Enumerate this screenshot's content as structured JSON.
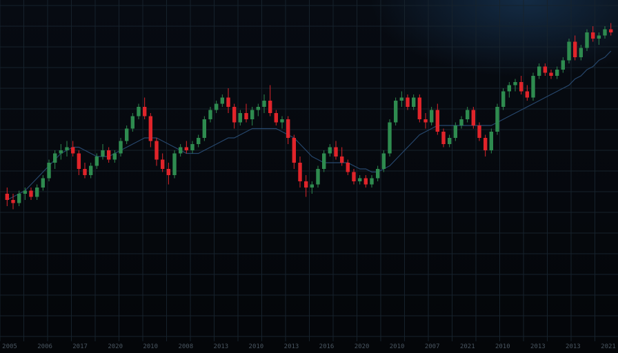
{
  "colors": {
    "up": "#2e8b4f",
    "down": "#e0242a",
    "moving_average": "#2b4f78",
    "grid": "#16222c",
    "background": "#05080d"
  },
  "chart_data": {
    "type": "candlestick",
    "grid": true,
    "legend": "none",
    "title": "",
    "xlabel": "",
    "ylabel": "",
    "ylim": [
      0,
      100
    ],
    "x_tick_labels": [
      "2005",
      "2006",
      "2017",
      "2020",
      "2010",
      "2008",
      "2013",
      "2010",
      "2013",
      "2016",
      "2020",
      "2010",
      "2007",
      "2021",
      "2010",
      "2013",
      "2013",
      "2021"
    ],
    "candles": [
      {
        "o": 42,
        "h": 44,
        "l": 38,
        "c": 40
      },
      {
        "o": 40,
        "h": 42,
        "l": 37,
        "c": 39
      },
      {
        "o": 39,
        "h": 43,
        "l": 38,
        "c": 42
      },
      {
        "o": 42,
        "h": 44,
        "l": 40,
        "c": 43
      },
      {
        "o": 43,
        "h": 44,
        "l": 40,
        "c": 41
      },
      {
        "o": 41,
        "h": 45,
        "l": 40,
        "c": 44
      },
      {
        "o": 44,
        "h": 48,
        "l": 43,
        "c": 47
      },
      {
        "o": 47,
        "h": 53,
        "l": 46,
        "c": 52
      },
      {
        "o": 52,
        "h": 56,
        "l": 50,
        "c": 55
      },
      {
        "o": 55,
        "h": 58,
        "l": 53,
        "c": 56
      },
      {
        "o": 56,
        "h": 59,
        "l": 54,
        "c": 57
      },
      {
        "o": 57,
        "h": 59,
        "l": 54,
        "c": 55
      },
      {
        "o": 55,
        "h": 56,
        "l": 48,
        "c": 50
      },
      {
        "o": 50,
        "h": 52,
        "l": 47,
        "c": 48
      },
      {
        "o": 48,
        "h": 52,
        "l": 47,
        "c": 51
      },
      {
        "o": 51,
        "h": 55,
        "l": 50,
        "c": 54
      },
      {
        "o": 54,
        "h": 58,
        "l": 53,
        "c": 56
      },
      {
        "o": 56,
        "h": 57,
        "l": 52,
        "c": 53
      },
      {
        "o": 53,
        "h": 56,
        "l": 52,
        "c": 55
      },
      {
        "o": 55,
        "h": 60,
        "l": 54,
        "c": 59
      },
      {
        "o": 59,
        "h": 64,
        "l": 58,
        "c": 63
      },
      {
        "o": 63,
        "h": 68,
        "l": 62,
        "c": 67
      },
      {
        "o": 67,
        "h": 71,
        "l": 66,
        "c": 70
      },
      {
        "o": 70,
        "h": 73,
        "l": 66,
        "c": 67
      },
      {
        "o": 67,
        "h": 68,
        "l": 57,
        "c": 59
      },
      {
        "o": 59,
        "h": 60,
        "l": 51,
        "c": 53
      },
      {
        "o": 53,
        "h": 55,
        "l": 49,
        "c": 50
      },
      {
        "o": 50,
        "h": 52,
        "l": 45,
        "c": 48
      },
      {
        "o": 48,
        "h": 56,
        "l": 47,
        "c": 55
      },
      {
        "o": 55,
        "h": 58,
        "l": 54,
        "c": 57
      },
      {
        "o": 57,
        "h": 59,
        "l": 55,
        "c": 56
      },
      {
        "o": 56,
        "h": 59,
        "l": 55,
        "c": 58
      },
      {
        "o": 58,
        "h": 61,
        "l": 57,
        "c": 60
      },
      {
        "o": 60,
        "h": 67,
        "l": 59,
        "c": 66
      },
      {
        "o": 66,
        "h": 70,
        "l": 65,
        "c": 69
      },
      {
        "o": 69,
        "h": 72,
        "l": 68,
        "c": 71
      },
      {
        "o": 71,
        "h": 74,
        "l": 70,
        "c": 73
      },
      {
        "o": 73,
        "h": 76,
        "l": 68,
        "c": 70
      },
      {
        "o": 70,
        "h": 71,
        "l": 63,
        "c": 65
      },
      {
        "o": 65,
        "h": 69,
        "l": 64,
        "c": 68
      },
      {
        "o": 68,
        "h": 71,
        "l": 65,
        "c": 66
      },
      {
        "o": 66,
        "h": 70,
        "l": 64,
        "c": 69
      },
      {
        "o": 69,
        "h": 71,
        "l": 67,
        "c": 70
      },
      {
        "o": 70,
        "h": 74,
        "l": 68,
        "c": 72
      },
      {
        "o": 72,
        "h": 77,
        "l": 67,
        "c": 68
      },
      {
        "o": 68,
        "h": 69,
        "l": 64,
        "c": 65
      },
      {
        "o": 65,
        "h": 67,
        "l": 63,
        "c": 66
      },
      {
        "o": 66,
        "h": 67,
        "l": 58,
        "c": 60
      },
      {
        "o": 60,
        "h": 61,
        "l": 50,
        "c": 52
      },
      {
        "o": 52,
        "h": 54,
        "l": 44,
        "c": 46
      },
      {
        "o": 46,
        "h": 48,
        "l": 41,
        "c": 44
      },
      {
        "o": 44,
        "h": 46,
        "l": 42,
        "c": 45
      },
      {
        "o": 45,
        "h": 51,
        "l": 44,
        "c": 50
      },
      {
        "o": 50,
        "h": 56,
        "l": 49,
        "c": 55
      },
      {
        "o": 55,
        "h": 58,
        "l": 54,
        "c": 57
      },
      {
        "o": 57,
        "h": 59,
        "l": 53,
        "c": 54
      },
      {
        "o": 54,
        "h": 57,
        "l": 51,
        "c": 52
      },
      {
        "o": 52,
        "h": 53,
        "l": 48,
        "c": 49
      },
      {
        "o": 49,
        "h": 50,
        "l": 45,
        "c": 46
      },
      {
        "o": 46,
        "h": 48,
        "l": 45,
        "c": 47
      },
      {
        "o": 47,
        "h": 48,
        "l": 44,
        "c": 45
      },
      {
        "o": 45,
        "h": 48,
        "l": 44,
        "c": 47
      },
      {
        "o": 47,
        "h": 51,
        "l": 46,
        "c": 50
      },
      {
        "o": 50,
        "h": 56,
        "l": 49,
        "c": 55
      },
      {
        "o": 55,
        "h": 66,
        "l": 54,
        "c": 65
      },
      {
        "o": 65,
        "h": 73,
        "l": 64,
        "c": 72
      },
      {
        "o": 72,
        "h": 75,
        "l": 70,
        "c": 73
      },
      {
        "o": 73,
        "h": 74,
        "l": 69,
        "c": 70
      },
      {
        "o": 70,
        "h": 74,
        "l": 69,
        "c": 73
      },
      {
        "o": 73,
        "h": 74,
        "l": 65,
        "c": 66
      },
      {
        "o": 66,
        "h": 68,
        "l": 63,
        "c": 65
      },
      {
        "o": 65,
        "h": 70,
        "l": 64,
        "c": 69
      },
      {
        "o": 69,
        "h": 71,
        "l": 61,
        "c": 62
      },
      {
        "o": 62,
        "h": 63,
        "l": 57,
        "c": 58
      },
      {
        "o": 58,
        "h": 61,
        "l": 57,
        "c": 60
      },
      {
        "o": 60,
        "h": 65,
        "l": 59,
        "c": 64
      },
      {
        "o": 64,
        "h": 67,
        "l": 63,
        "c": 66
      },
      {
        "o": 66,
        "h": 70,
        "l": 65,
        "c": 69
      },
      {
        "o": 69,
        "h": 70,
        "l": 63,
        "c": 64
      },
      {
        "o": 64,
        "h": 65,
        "l": 59,
        "c": 60
      },
      {
        "o": 60,
        "h": 61,
        "l": 54,
        "c": 56
      },
      {
        "o": 56,
        "h": 63,
        "l": 55,
        "c": 62
      },
      {
        "o": 62,
        "h": 71,
        "l": 61,
        "c": 70
      },
      {
        "o": 70,
        "h": 76,
        "l": 69,
        "c": 75
      },
      {
        "o": 75,
        "h": 78,
        "l": 73,
        "c": 77
      },
      {
        "o": 77,
        "h": 79,
        "l": 75,
        "c": 78
      },
      {
        "o": 78,
        "h": 80,
        "l": 74,
        "c": 75
      },
      {
        "o": 75,
        "h": 77,
        "l": 72,
        "c": 73
      },
      {
        "o": 73,
        "h": 81,
        "l": 72,
        "c": 80
      },
      {
        "o": 80,
        "h": 84,
        "l": 79,
        "c": 83
      },
      {
        "o": 83,
        "h": 84,
        "l": 80,
        "c": 81
      },
      {
        "o": 81,
        "h": 82,
        "l": 79,
        "c": 80
      },
      {
        "o": 80,
        "h": 83,
        "l": 79,
        "c": 82
      },
      {
        "o": 82,
        "h": 86,
        "l": 81,
        "c": 85
      },
      {
        "o": 85,
        "h": 92,
        "l": 84,
        "c": 91
      },
      {
        "o": 91,
        "h": 93,
        "l": 85,
        "c": 86
      },
      {
        "o": 86,
        "h": 90,
        "l": 85,
        "c": 89
      },
      {
        "o": 89,
        "h": 95,
        "l": 88,
        "c": 94
      },
      {
        "o": 94,
        "h": 96,
        "l": 91,
        "c": 92
      },
      {
        "o": 92,
        "h": 94,
        "l": 90,
        "c": 93
      },
      {
        "o": 93,
        "h": 96,
        "l": 92,
        "c": 95
      },
      {
        "o": 95,
        "h": 97,
        "l": 93,
        "c": 94
      }
    ],
    "series": [
      {
        "type": "moving-average",
        "values": [
          40,
          41,
          42,
          43,
          45,
          47,
          49,
          51,
          53,
          55,
          56,
          57,
          57,
          56,
          55,
          54,
          54,
          54,
          55,
          56,
          57,
          58,
          59,
          60,
          60,
          60,
          59,
          58,
          57,
          56,
          55,
          55,
          55,
          56,
          57,
          58,
          59,
          60,
          60,
          61,
          62,
          63,
          63,
          63,
          63,
          63,
          62,
          61,
          60,
          58,
          56,
          54,
          53,
          52,
          52,
          52,
          52,
          52,
          51,
          50,
          50,
          49,
          49,
          50,
          51,
          53,
          55,
          57,
          59,
          61,
          62,
          63,
          64,
          64,
          64,
          64,
          64,
          64,
          64,
          64,
          64,
          64,
          65,
          66,
          67,
          68,
          69,
          70,
          71,
          72,
          73,
          74,
          75,
          76,
          77,
          79,
          80,
          82,
          83,
          85,
          86,
          88
        ]
      }
    ]
  }
}
